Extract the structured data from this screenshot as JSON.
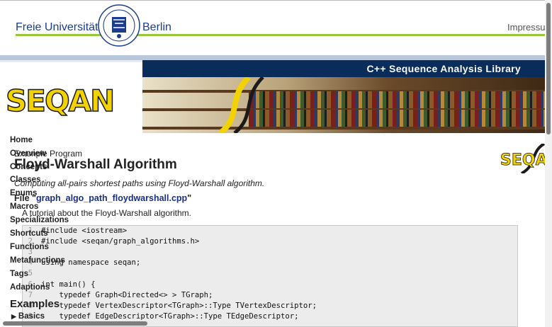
{
  "header": {
    "name_left": "Freie Universität",
    "name_right": "Berlin",
    "impressum": "Impressum"
  },
  "seqan_bar": {
    "title": "C++ Sequence Analysis Library"
  },
  "banner": {
    "logo_text": "SEQAN"
  },
  "small_logo": {
    "text": "SEQAN"
  },
  "sidebar": {
    "items": [
      "Home",
      "Overview",
      "Concepts",
      "Classes",
      "Enums",
      "Macros",
      "Specializations",
      "Shortcuts",
      "Functions",
      "Metafunctions",
      "Tags",
      "Adaptions"
    ],
    "examples_heading": "Examples",
    "basics": "Basics"
  },
  "content": {
    "breadcrumb": "Example Program",
    "title": "Floyd-Warshall Algorithm",
    "subtitle": "Computing all-pairs shortest paths using Floyd-Warshall algorithm.",
    "file_label": "File \"",
    "file_name": "graph_algo_path_floydwarshall.cpp",
    "file_close": "\"",
    "tutorial": "A tutorial about the Floyd-Warshall algorithm."
  },
  "code": {
    "lines": [
      {
        "n": "1",
        "text": "#include <iostream>"
      },
      {
        "n": "2",
        "text": "#include <seqan/graph_algorithms.h>"
      },
      {
        "n": "3",
        "text": ""
      },
      {
        "n": "4",
        "text": "using namespace seqan;"
      },
      {
        "n": "5",
        "text": ""
      },
      {
        "n": "6",
        "text": "int main() {"
      },
      {
        "n": "7",
        "text": "    typedef Graph<Directed<> > TGraph;"
      },
      {
        "n": "8",
        "text": "    typedef VertexDescriptor<TGraph>::Type TVertexDescriptor;"
      },
      {
        "n": "9",
        "text": "    typedef EdgeDescriptor<TGraph>::Type TEdgeDescriptor;"
      }
    ]
  }
}
